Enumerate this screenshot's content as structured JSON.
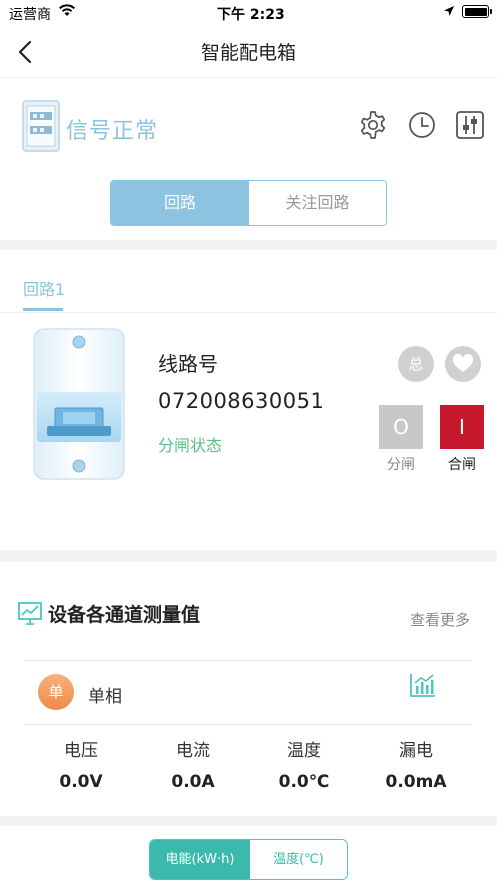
{
  "status_bar": {
    "carrier": "运营商",
    "time": "下午 2:23"
  },
  "nav": {
    "title": "智能配电箱"
  },
  "header": {
    "signal_status": "信号正常",
    "icons": [
      "settings-icon",
      "clock-icon",
      "sliders-icon"
    ]
  },
  "segments": {
    "active": "回路",
    "inactive": "关注回路"
  },
  "loop_tabs": {
    "current": "回路1"
  },
  "breaker": {
    "line_label": "线路号",
    "line_number": "072008630051",
    "state_label": "分闸状态",
    "master_badge": "总",
    "off_symbol": "O",
    "on_symbol": "I",
    "off_label": "分闸",
    "on_label": "合闸"
  },
  "measurements": {
    "title": "设备各通道测量值",
    "more_link": "查看更多",
    "phase_badge": "单",
    "phase_label": "单相",
    "columns": [
      {
        "name": "电压",
        "value": "0.0V"
      },
      {
        "name": "电流",
        "value": "0.0A"
      },
      {
        "name": "温度",
        "value": "0.0℃"
      },
      {
        "name": "漏电",
        "value": "0.0mA"
      }
    ]
  },
  "bottom_toggle": {
    "active": "电能(kW·h)",
    "inactive": "温度(℃)"
  },
  "colors": {
    "accent_blue": "#8cc3e0",
    "accent_teal": "#3cb9ad",
    "status_green": "#5cbf8a",
    "close_red": "#c7192e",
    "badge_orange": "#ef8a4c"
  }
}
